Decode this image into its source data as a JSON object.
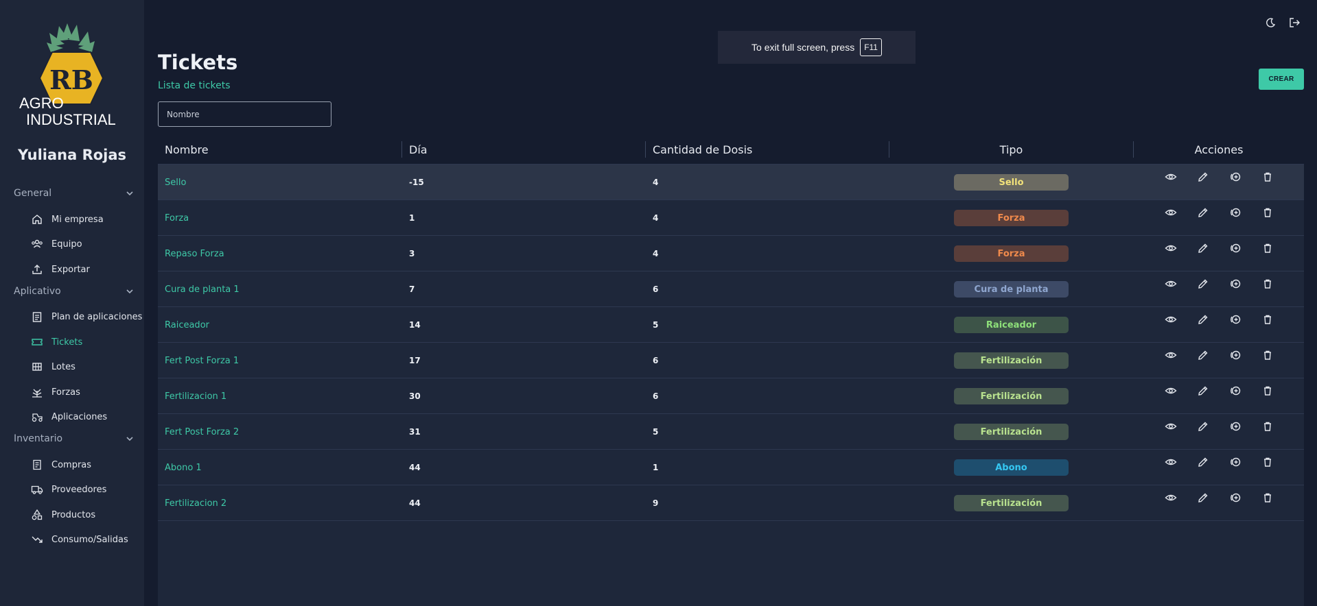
{
  "sidebar": {
    "brand": {
      "line1": "AGRO",
      "line2": "INDUSTRIAL",
      "mark": "RB"
    },
    "user_name": "Yuliana Rojas",
    "sections": [
      {
        "label": "General",
        "items": [
          {
            "label": "Mi empresa",
            "icon": "home-icon"
          },
          {
            "label": "Equipo",
            "icon": "users-icon"
          },
          {
            "label": "Exportar",
            "icon": "export-icon"
          }
        ]
      },
      {
        "label": "Aplicativo",
        "items": [
          {
            "label": "Plan de aplicaciones",
            "icon": "clipboard-icon"
          },
          {
            "label": "Tickets",
            "icon": "ticket-icon",
            "active": true
          },
          {
            "label": "Lotes",
            "icon": "grid-icon"
          },
          {
            "label": "Forzas",
            "icon": "plant-icon"
          },
          {
            "label": "Aplicaciones",
            "icon": "tractor-icon"
          }
        ]
      },
      {
        "label": "Inventario",
        "items": [
          {
            "label": "Compras",
            "icon": "receipt-icon"
          },
          {
            "label": "Proveedores",
            "icon": "truck-icon"
          },
          {
            "label": "Productos",
            "icon": "shapes-icon"
          },
          {
            "label": "Consumo/Salidas",
            "icon": "trend-down-icon"
          }
        ]
      }
    ]
  },
  "header": {
    "title": "Tickets",
    "subtitle": "Lista de tickets",
    "create_label": "CREAR",
    "icons": [
      "moon-icon",
      "logout-icon"
    ]
  },
  "search": {
    "placeholder": "Nombre",
    "value": ""
  },
  "fullscreen_toast": {
    "text": "To exit full screen, press",
    "key": "F11"
  },
  "table": {
    "columns": [
      "Nombre",
      "Día",
      "Cantidad de Dosis",
      "Tipo",
      "Acciones"
    ],
    "rows": [
      {
        "name": "Sello",
        "day": "-15",
        "doses": "4",
        "type": "Sello"
      },
      {
        "name": "Forza",
        "day": "1",
        "doses": "4",
        "type": "Forza"
      },
      {
        "name": "Repaso Forza",
        "day": "3",
        "doses": "4",
        "type": "Forza"
      },
      {
        "name": "Cura de planta 1",
        "day": "7",
        "doses": "6",
        "type": "Cura de planta"
      },
      {
        "name": "Raiceador",
        "day": "14",
        "doses": "5",
        "type": "Raiceador"
      },
      {
        "name": "Fert Post Forza 1",
        "day": "17",
        "doses": "6",
        "type": "Fertilización"
      },
      {
        "name": "Fertilizacion 1",
        "day": "30",
        "doses": "6",
        "type": "Fertilización"
      },
      {
        "name": "Fert Post Forza 2",
        "day": "31",
        "doses": "5",
        "type": "Fertilización"
      },
      {
        "name": "Abono 1",
        "day": "44",
        "doses": "1",
        "type": "Abono"
      },
      {
        "name": "Fertilizacion 2",
        "day": "44",
        "doses": "9",
        "type": "Fertilización"
      }
    ],
    "action_icons": [
      "eye-icon",
      "pencil-icon",
      "plus-circle-icon",
      "trash-icon"
    ]
  },
  "badge_colors": {
    "Sello": {
      "bg": "#6b6a62",
      "fg": "#f2e27a"
    },
    "Forza": {
      "bg": "#5a3e3a",
      "fg": "#f08a4c"
    },
    "Cura de planta": {
      "bg": "#3d4a66",
      "fg": "#8fa6cf"
    },
    "Raiceador": {
      "bg": "#3d5448",
      "fg": "#8ee07a"
    },
    "Fertilización": {
      "bg": "#45564e",
      "fg": "#b9e28f"
    },
    "Abono": {
      "bg": "#1e4e6e",
      "fg": "#35c7f2"
    }
  },
  "colors": {
    "accent": "#3ec9a7",
    "background": "#151c2e",
    "sidebar": "#1e2638"
  }
}
